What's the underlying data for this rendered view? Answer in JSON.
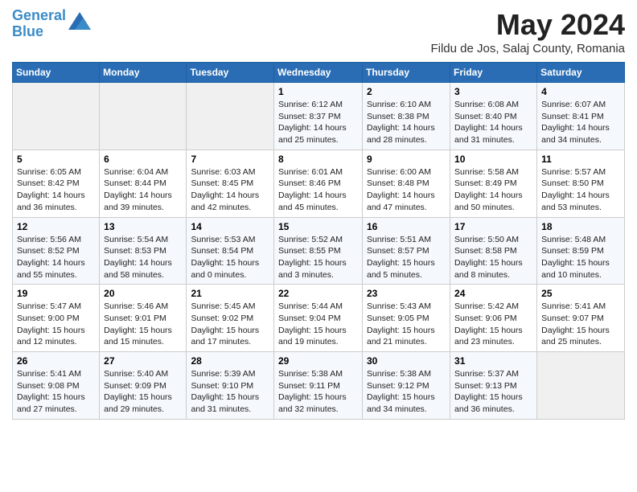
{
  "header": {
    "logo_line1": "General",
    "logo_line2": "Blue",
    "month": "May 2024",
    "location": "Fildu de Jos, Salaj County, Romania"
  },
  "weekdays": [
    "Sunday",
    "Monday",
    "Tuesday",
    "Wednesday",
    "Thursday",
    "Friday",
    "Saturday"
  ],
  "weeks": [
    [
      {
        "day": "",
        "sunrise": "",
        "sunset": "",
        "daylight": ""
      },
      {
        "day": "",
        "sunrise": "",
        "sunset": "",
        "daylight": ""
      },
      {
        "day": "",
        "sunrise": "",
        "sunset": "",
        "daylight": ""
      },
      {
        "day": "1",
        "sunrise": "Sunrise: 6:12 AM",
        "sunset": "Sunset: 8:37 PM",
        "daylight": "Daylight: 14 hours and 25 minutes."
      },
      {
        "day": "2",
        "sunrise": "Sunrise: 6:10 AM",
        "sunset": "Sunset: 8:38 PM",
        "daylight": "Daylight: 14 hours and 28 minutes."
      },
      {
        "day": "3",
        "sunrise": "Sunrise: 6:08 AM",
        "sunset": "Sunset: 8:40 PM",
        "daylight": "Daylight: 14 hours and 31 minutes."
      },
      {
        "day": "4",
        "sunrise": "Sunrise: 6:07 AM",
        "sunset": "Sunset: 8:41 PM",
        "daylight": "Daylight: 14 hours and 34 minutes."
      }
    ],
    [
      {
        "day": "5",
        "sunrise": "Sunrise: 6:05 AM",
        "sunset": "Sunset: 8:42 PM",
        "daylight": "Daylight: 14 hours and 36 minutes."
      },
      {
        "day": "6",
        "sunrise": "Sunrise: 6:04 AM",
        "sunset": "Sunset: 8:44 PM",
        "daylight": "Daylight: 14 hours and 39 minutes."
      },
      {
        "day": "7",
        "sunrise": "Sunrise: 6:03 AM",
        "sunset": "Sunset: 8:45 PM",
        "daylight": "Daylight: 14 hours and 42 minutes."
      },
      {
        "day": "8",
        "sunrise": "Sunrise: 6:01 AM",
        "sunset": "Sunset: 8:46 PM",
        "daylight": "Daylight: 14 hours and 45 minutes."
      },
      {
        "day": "9",
        "sunrise": "Sunrise: 6:00 AM",
        "sunset": "Sunset: 8:48 PM",
        "daylight": "Daylight: 14 hours and 47 minutes."
      },
      {
        "day": "10",
        "sunrise": "Sunrise: 5:58 AM",
        "sunset": "Sunset: 8:49 PM",
        "daylight": "Daylight: 14 hours and 50 minutes."
      },
      {
        "day": "11",
        "sunrise": "Sunrise: 5:57 AM",
        "sunset": "Sunset: 8:50 PM",
        "daylight": "Daylight: 14 hours and 53 minutes."
      }
    ],
    [
      {
        "day": "12",
        "sunrise": "Sunrise: 5:56 AM",
        "sunset": "Sunset: 8:52 PM",
        "daylight": "Daylight: 14 hours and 55 minutes."
      },
      {
        "day": "13",
        "sunrise": "Sunrise: 5:54 AM",
        "sunset": "Sunset: 8:53 PM",
        "daylight": "Daylight: 14 hours and 58 minutes."
      },
      {
        "day": "14",
        "sunrise": "Sunrise: 5:53 AM",
        "sunset": "Sunset: 8:54 PM",
        "daylight": "Daylight: 15 hours and 0 minutes."
      },
      {
        "day": "15",
        "sunrise": "Sunrise: 5:52 AM",
        "sunset": "Sunset: 8:55 PM",
        "daylight": "Daylight: 15 hours and 3 minutes."
      },
      {
        "day": "16",
        "sunrise": "Sunrise: 5:51 AM",
        "sunset": "Sunset: 8:57 PM",
        "daylight": "Daylight: 15 hours and 5 minutes."
      },
      {
        "day": "17",
        "sunrise": "Sunrise: 5:50 AM",
        "sunset": "Sunset: 8:58 PM",
        "daylight": "Daylight: 15 hours and 8 minutes."
      },
      {
        "day": "18",
        "sunrise": "Sunrise: 5:48 AM",
        "sunset": "Sunset: 8:59 PM",
        "daylight": "Daylight: 15 hours and 10 minutes."
      }
    ],
    [
      {
        "day": "19",
        "sunrise": "Sunrise: 5:47 AM",
        "sunset": "Sunset: 9:00 PM",
        "daylight": "Daylight: 15 hours and 12 minutes."
      },
      {
        "day": "20",
        "sunrise": "Sunrise: 5:46 AM",
        "sunset": "Sunset: 9:01 PM",
        "daylight": "Daylight: 15 hours and 15 minutes."
      },
      {
        "day": "21",
        "sunrise": "Sunrise: 5:45 AM",
        "sunset": "Sunset: 9:02 PM",
        "daylight": "Daylight: 15 hours and 17 minutes."
      },
      {
        "day": "22",
        "sunrise": "Sunrise: 5:44 AM",
        "sunset": "Sunset: 9:04 PM",
        "daylight": "Daylight: 15 hours and 19 minutes."
      },
      {
        "day": "23",
        "sunrise": "Sunrise: 5:43 AM",
        "sunset": "Sunset: 9:05 PM",
        "daylight": "Daylight: 15 hours and 21 minutes."
      },
      {
        "day": "24",
        "sunrise": "Sunrise: 5:42 AM",
        "sunset": "Sunset: 9:06 PM",
        "daylight": "Daylight: 15 hours and 23 minutes."
      },
      {
        "day": "25",
        "sunrise": "Sunrise: 5:41 AM",
        "sunset": "Sunset: 9:07 PM",
        "daylight": "Daylight: 15 hours and 25 minutes."
      }
    ],
    [
      {
        "day": "26",
        "sunrise": "Sunrise: 5:41 AM",
        "sunset": "Sunset: 9:08 PM",
        "daylight": "Daylight: 15 hours and 27 minutes."
      },
      {
        "day": "27",
        "sunrise": "Sunrise: 5:40 AM",
        "sunset": "Sunset: 9:09 PM",
        "daylight": "Daylight: 15 hours and 29 minutes."
      },
      {
        "day": "28",
        "sunrise": "Sunrise: 5:39 AM",
        "sunset": "Sunset: 9:10 PM",
        "daylight": "Daylight: 15 hours and 31 minutes."
      },
      {
        "day": "29",
        "sunrise": "Sunrise: 5:38 AM",
        "sunset": "Sunset: 9:11 PM",
        "daylight": "Daylight: 15 hours and 32 minutes."
      },
      {
        "day": "30",
        "sunrise": "Sunrise: 5:38 AM",
        "sunset": "Sunset: 9:12 PM",
        "daylight": "Daylight: 15 hours and 34 minutes."
      },
      {
        "day": "31",
        "sunrise": "Sunrise: 5:37 AM",
        "sunset": "Sunset: 9:13 PM",
        "daylight": "Daylight: 15 hours and 36 minutes."
      },
      {
        "day": "",
        "sunrise": "",
        "sunset": "",
        "daylight": ""
      }
    ]
  ]
}
